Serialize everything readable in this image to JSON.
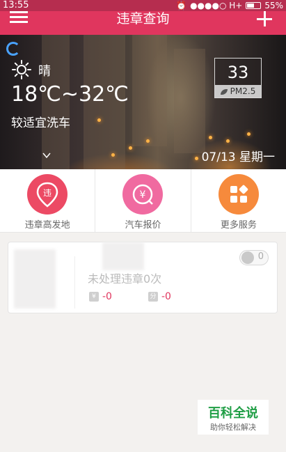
{
  "status_bar": {
    "time": "13:55",
    "carrier": "●●●●○ H+",
    "battery": "55%"
  },
  "header": {
    "title": "违章查询",
    "menu_icon": "menu-icon",
    "add_icon": "plus-icon"
  },
  "weather": {
    "condition": "晴",
    "condition_icon": "sun-icon",
    "temperature": "18℃~32℃",
    "car_wash": "较适宜洗车",
    "date": "07/13 星期一",
    "pm_value": "33",
    "pm_label": "PM2.5"
  },
  "services": [
    {
      "label": "违章高发地",
      "icon": "violation-location-icon",
      "icon_glyph": "违",
      "color": "#ec4a64"
    },
    {
      "label": "汽车报价",
      "icon": "car-price-icon",
      "icon_glyph": "¥",
      "color": "#f06aa0"
    },
    {
      "label": "更多服务",
      "icon": "more-services-icon",
      "icon_glyph": "",
      "color": "#f68a3c"
    }
  ],
  "violation_card": {
    "summary": "未处理违章0次",
    "fine_badge": "¥",
    "fine_value": "-0",
    "points_badge": "分",
    "points_value": "-0",
    "like_count": "0"
  },
  "watermark": {
    "title": "百科全说",
    "subtitle": "助你轻松解决"
  }
}
